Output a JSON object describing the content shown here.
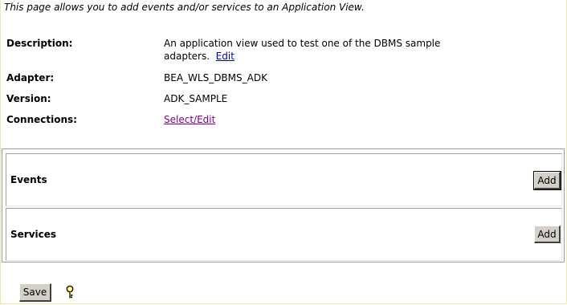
{
  "intro_text": "This page allows you to add events and/or services to an Application View.",
  "fields": {
    "description": {
      "label": "Description:",
      "value": "An application view used to test one of the DBMS sample adapters.",
      "edit_link": "Edit"
    },
    "adapter": {
      "label": "Adapter:",
      "value": "BEA_WLS_DBMS_ADK"
    },
    "version": {
      "label": "Version:",
      "value": "ADK_SAMPLE"
    },
    "connections": {
      "label": "Connections:",
      "link": "Select/Edit"
    }
  },
  "events": {
    "title": "Events",
    "add_label": "Add"
  },
  "services": {
    "title": "Services",
    "add_label": "Add"
  },
  "footer": {
    "save_label": "Save",
    "help_icon": "help-key-icon"
  },
  "colors": {
    "frame_border": "#efe8a3",
    "link": "#0000cc",
    "visited_link": "#800080",
    "button_face": "#d4d0c8",
    "help_icon": "#e8d400"
  }
}
